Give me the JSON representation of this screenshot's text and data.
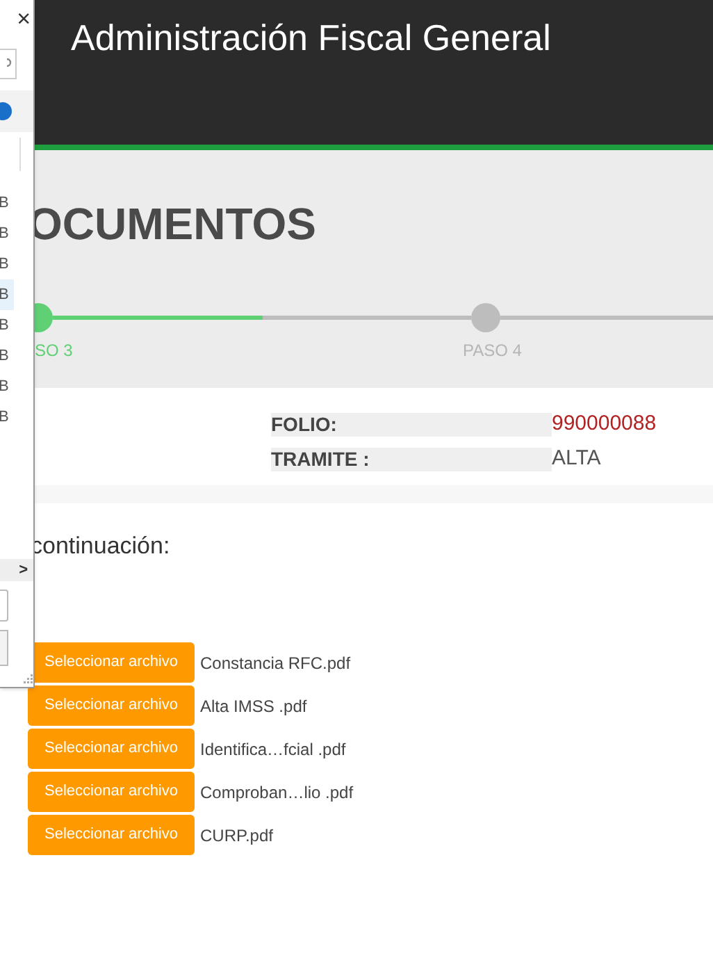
{
  "header": {
    "title": "Administración Fiscal General"
  },
  "page_title": "OCUMENTOS",
  "stepper": {
    "level": 0.5,
    "steps": [
      {
        "label": "SO 3",
        "done": true
      },
      {
        "label": "PASO 4",
        "done": false
      }
    ]
  },
  "info": [
    {
      "label": "FOLIO:",
      "value": "990000088",
      "emphasis": true
    },
    {
      "label": "TRAMITE :",
      "value": "ALTA",
      "emphasis": false
    }
  ],
  "instruction": "continuación:",
  "files": [
    {
      "button": "Seleccionar archivo",
      "file": "Constancia RFC.pdf"
    },
    {
      "button": "Seleccionar archivo",
      "file": "Alta IMSS .pdf"
    },
    {
      "button": "Seleccionar archivo",
      "file": "Identifica…fcial .pdf"
    },
    {
      "button": "Seleccionar archivo",
      "file": "Comproban…lio .pdf"
    },
    {
      "button": "Seleccionar archivo",
      "file": "CURP.pdf"
    }
  ],
  "dialog": {
    "close": "×",
    "scroll_right": ">",
    "items": [
      {
        "text": "B",
        "selected": false
      },
      {
        "text": "B",
        "selected": false
      },
      {
        "text": "B",
        "selected": false
      },
      {
        "text": "B",
        "selected": true
      },
      {
        "text": "B",
        "selected": false
      },
      {
        "text": "B",
        "selected": false
      },
      {
        "text": "B",
        "selected": false
      },
      {
        "text": "B",
        "selected": false
      }
    ]
  }
}
